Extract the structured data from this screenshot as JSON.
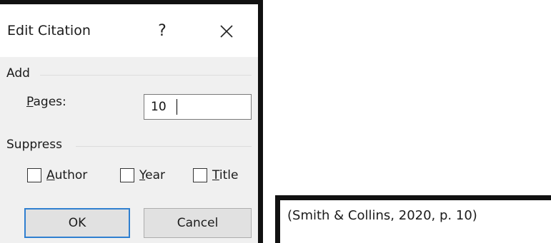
{
  "dialog": {
    "title": "Edit Citation",
    "help_label": "?",
    "close_icon": "close-icon",
    "add_group": {
      "label": "Add",
      "pages_label_mnemonic": "P",
      "pages_label_rest": "ages:",
      "pages_value": "10"
    },
    "suppress_group": {
      "label": "Suppress",
      "options": [
        {
          "mnemonic": "A",
          "rest": "uthor",
          "checked": false
        },
        {
          "mnemonic": "Y",
          "rest": "ear",
          "checked": false
        },
        {
          "mnemonic": "T",
          "rest": "itle",
          "checked": false
        }
      ]
    },
    "ok_label": "OK",
    "cancel_label": "Cancel"
  },
  "preview": {
    "citation_text": "(Smith & Collins, 2020, p. 10)"
  },
  "colors": {
    "dialog_body": "#f0f0f0",
    "button_face": "#e1e1e1",
    "focus_border": "#2f7fd0",
    "frame_border": "#111111"
  }
}
